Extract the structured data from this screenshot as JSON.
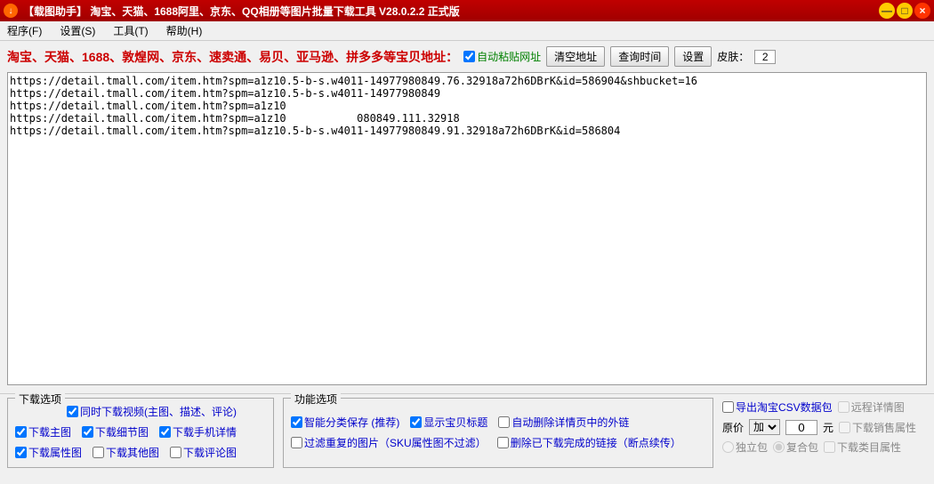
{
  "title_bar": {
    "icon": "↓",
    "text": "【载图助手】 淘宝、天猫、1688阿里、京东、QQ相册等图片批量下载工具 V28.0.2.2 正式版"
  },
  "menu": {
    "program": "程序(F)",
    "settings": "设置(S)",
    "tools": "工具(T)",
    "help": "帮助(H)"
  },
  "header": {
    "label": "淘宝、天猫、1688、敦煌网、京东、速卖通、易贝、亚马逊、拼多多等宝贝地址：",
    "auto_paste": "自动粘贴网址",
    "clear_btn": "清空地址",
    "query_time_btn": "查询时间",
    "settings_btn": "设置",
    "skin_label": "皮肤：",
    "skin_value": "2"
  },
  "url_text": "https://detail.tmall.com/item.htm?spm=a1z10.5-b-s.w4011-14977980849.76.32918a72h6DBrK&id=586904&shbucket=16\nhttps://detail.tmall.com/item.htm?spm=a1z10.5-b-s.w4011-14977980849\nhttps://detail.tmall.com/item.htm?spm=a1z10\nhttps://detail.tmall.com/item.htm?spm=a1z10           080849.111.32918\nhttps://detail.tmall.com/item.htm?spm=a1z10.5-b-s.w4011-14977980849.91.32918a72h6DBrK&id=586804",
  "download_options": {
    "legend": "下载选项",
    "download_video": "同时下载视频(主图、描述、评论)",
    "main_img": "下载主图",
    "detail_img": "下载细节图",
    "mobile_detail": "下载手机详情",
    "attr_img": "下载属性图",
    "other_img": "下载其他图",
    "comment_img": "下载评论图"
  },
  "function_options": {
    "legend": "功能选项",
    "smart_save": "智能分类保存 (推荐)",
    "show_title": "显示宝贝标题",
    "auto_delete_ext": "自动删除详情页中的外链",
    "filter_dup": "过滤重复的图片（SKU属性图不过滤）",
    "delete_done": "删除已下载完成的链接（断点续传）"
  },
  "right_options": {
    "export_csv": "导出淘宝CSV数据包",
    "remote_detail": "远程详情图",
    "price_label": "原价",
    "price_op": "加",
    "price_value": "0",
    "price_unit": "元",
    "download_sale": "下载销售属性",
    "standalone": "独立包",
    "composite": "复合包",
    "download_cat": "下载类目属性"
  }
}
